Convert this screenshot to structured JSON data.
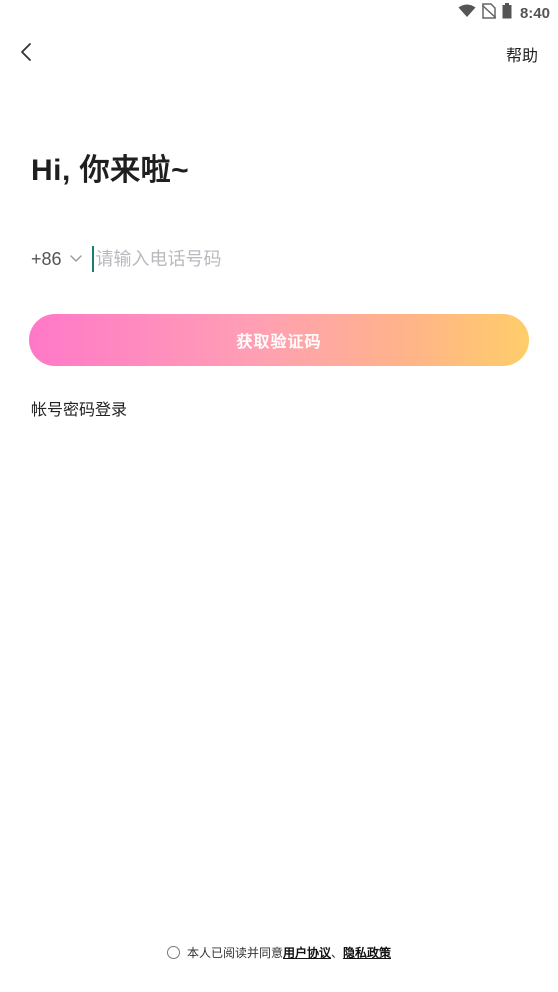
{
  "status_bar": {
    "time": "8:40",
    "icons": [
      "wifi-icon",
      "no-sim-icon",
      "battery-icon"
    ]
  },
  "nav": {
    "back_icon": "chevron-left-icon",
    "help_label": "帮助"
  },
  "greeting": "Hi, 你来啦~",
  "phone": {
    "country_code": "+86",
    "country_dropdown_icon": "chevron-down-icon",
    "value": "",
    "placeholder": "请输入电话号码"
  },
  "primary_button": {
    "label": "获取验证码"
  },
  "alternate_login": {
    "label": "帐号密码登录"
  },
  "agreement": {
    "prefix": "本人已阅读并同意",
    "user_agreement": "用户协议",
    "separator": "、",
    "privacy_policy": "隐私政策",
    "checked": false
  },
  "colors": {
    "gradient_start": "#ff78c8",
    "gradient_end": "#ffcd6a",
    "cursor": "#1a7d72",
    "placeholder": "#b9b9bf"
  }
}
